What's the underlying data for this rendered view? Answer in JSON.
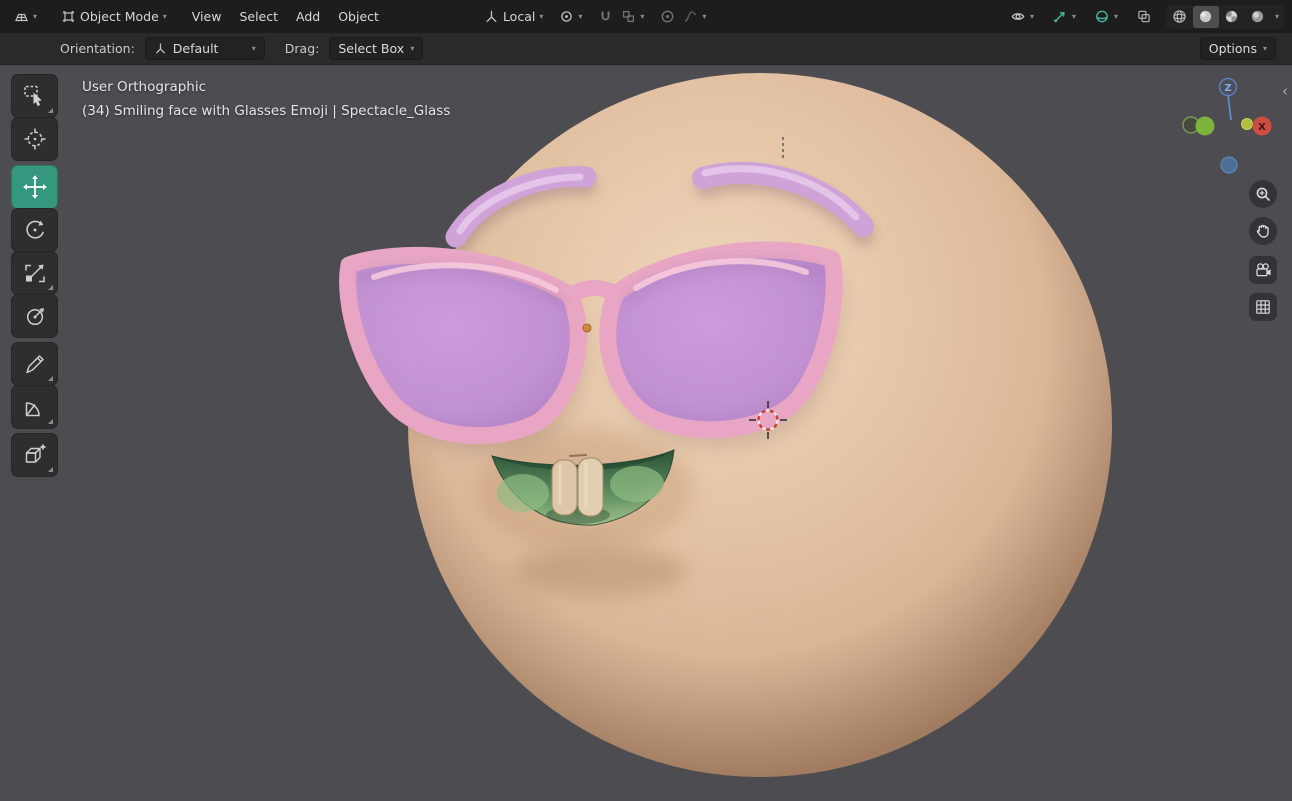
{
  "colors": {
    "accent_teal": "#36977f",
    "header_bg": "#1d1d1d",
    "tool_settings_bg": "#2a2a2d",
    "viewport_bg": "#4d4d51",
    "head_skin": "#ddb797",
    "glasses_frame": "#e8a6c4",
    "lens_purple": "#c291d2",
    "eyebrow_pink": "#cfa3d8",
    "mouth_green": "#4f7f55",
    "gizmo_x_red": "#cd4d42",
    "gizmo_y_green": "#7fb43c",
    "gizmo_z_blue": "#5f8ad0"
  },
  "topbar": {
    "editor_icon": "editor-type-icon",
    "mode_icon": "object-mode-icon",
    "mode_label": "Object Mode",
    "menus": [
      {
        "label": "View"
      },
      {
        "label": "Select"
      },
      {
        "label": "Add"
      },
      {
        "label": "Object"
      }
    ],
    "orientation_icon": "transform-orientation-icon",
    "orientation_value": "Local",
    "toggles": [
      {
        "name": "pivot-point-dropdown"
      },
      {
        "name": "snap-magnet-toggle"
      },
      {
        "name": "snap-target-dropdown"
      },
      {
        "name": "proportional-editing-toggle"
      },
      {
        "name": "proportional-falloff-dropdown"
      },
      {
        "name": "show-gizmos-dropdown"
      },
      {
        "name": "show-overlays-dropdown"
      },
      {
        "name": "xray-toggle"
      },
      {
        "name": "shading-wireframe"
      },
      {
        "name": "shading-solid",
        "active": true
      },
      {
        "name": "shading-material"
      },
      {
        "name": "shading-rendered"
      }
    ]
  },
  "tool_settings": {
    "orientation_label": "Orientation:",
    "orientation_value": "Default",
    "drag_label": "Drag:",
    "drag_value": "Select Box",
    "options_label": "Options"
  },
  "left_toolbar": {
    "tools": [
      {
        "name": "tweak-select-box"
      },
      {
        "name": "cursor"
      },
      {
        "name": "move",
        "active": true
      },
      {
        "name": "rotate"
      },
      {
        "name": "scale"
      },
      {
        "name": "transform"
      },
      {
        "name": "annotate"
      },
      {
        "name": "measure"
      },
      {
        "name": "add-cube"
      }
    ]
  },
  "viewport": {
    "view_mode_text": "User Orthographic",
    "active_object_text": "(34) Smiling face with Glasses Emoji | Spectacle_Glass"
  },
  "nav_gizmo": {
    "z_label": "Z",
    "x_label": "X"
  },
  "side_buttons": [
    {
      "name": "zoom-button"
    },
    {
      "name": "pan-hand-button"
    },
    {
      "name": "camera-view-button"
    },
    {
      "name": "toggle-ortho-button"
    }
  ]
}
